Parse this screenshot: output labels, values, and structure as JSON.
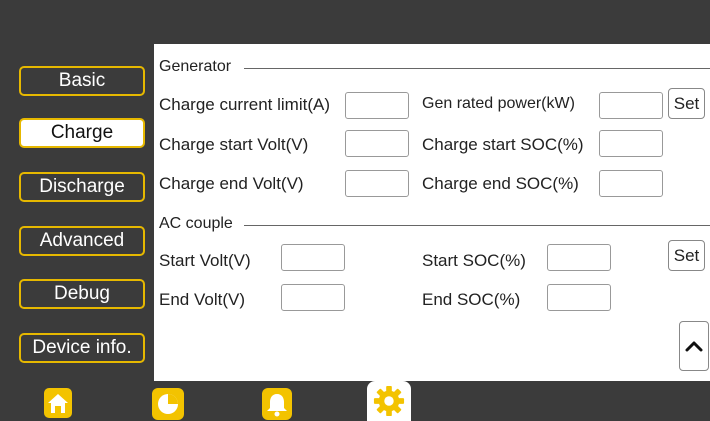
{
  "sidebar": {
    "items": [
      {
        "label": "Basic",
        "active": false
      },
      {
        "label": "Charge",
        "active": true
      },
      {
        "label": "Discharge",
        "active": false
      },
      {
        "label": "Advanced",
        "active": false
      },
      {
        "label": "Debug",
        "active": false
      },
      {
        "label": "Device info.",
        "active": false
      }
    ]
  },
  "generator": {
    "section_title": "Generator",
    "charge_current_limit_label": "Charge current limit(A)",
    "charge_current_limit_value": "",
    "gen_rated_power_label": "Gen rated power(kW)",
    "gen_rated_power_value": "",
    "set_label": "Set",
    "charge_start_volt_label": "Charge start Volt(V)",
    "charge_start_volt_value": "",
    "charge_start_soc_label": "Charge start SOC(%)",
    "charge_start_soc_value": "",
    "charge_end_volt_label": "Charge end Volt(V)",
    "charge_end_volt_value": "",
    "charge_end_soc_label": "Charge end SOC(%)",
    "charge_end_soc_value": ""
  },
  "ac_couple": {
    "section_title": "AC couple",
    "start_volt_label": "Start Volt(V)",
    "start_volt_value": "",
    "start_soc_label": "Start SOC(%)",
    "start_soc_value": "",
    "set_label": "Set",
    "end_volt_label": "End Volt(V)",
    "end_volt_value": "",
    "end_soc_label": "End SOC(%)",
    "end_soc_value": ""
  },
  "bottom_nav": {
    "items": [
      {
        "icon": "home-icon",
        "active": false
      },
      {
        "icon": "pie-chart-icon",
        "active": false
      },
      {
        "icon": "bell-icon",
        "active": false
      },
      {
        "icon": "gear-icon",
        "active": true
      }
    ]
  },
  "colors": {
    "accent": "#e6b800",
    "background": "#3b3b3b",
    "panel": "#ffffff"
  }
}
